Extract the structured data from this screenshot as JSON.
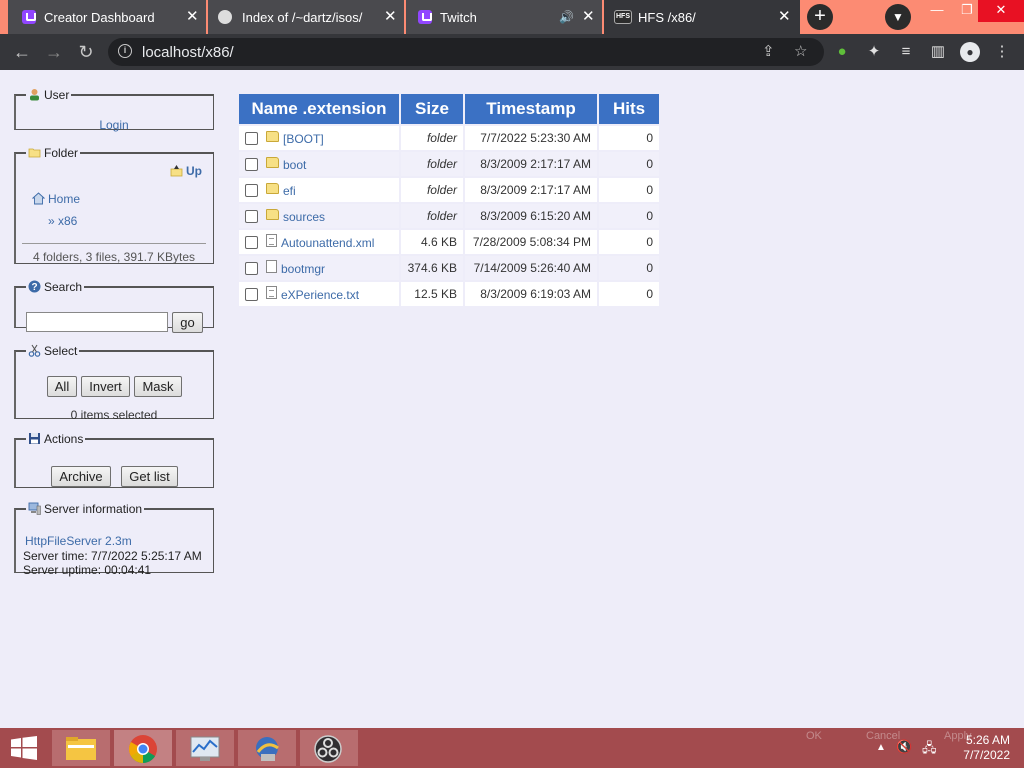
{
  "browser": {
    "tabs": [
      {
        "title": "Creator Dashboard",
        "favicon": "twitch-icon"
      },
      {
        "title": "Index of /~dartz/isos/",
        "favicon": "dartz-icon"
      },
      {
        "title": "Twitch",
        "favicon": "twitch-icon"
      },
      {
        "title": "HFS /x86/",
        "favicon": "hfs-icon",
        "favicon_text": "HFS"
      }
    ],
    "url": "localhost/x86/"
  },
  "sidebar": {
    "user": {
      "legend": "User",
      "login_link": "Login"
    },
    "folder": {
      "legend": "Folder",
      "up_link": "Up",
      "home_link": "Home",
      "current_link": "» x86",
      "summary": "4 folders, 3 files, 391.7 KBytes"
    },
    "search": {
      "legend": "Search",
      "input_value": "",
      "go_button": "go"
    },
    "select": {
      "legend": "Select",
      "buttons": [
        "All",
        "Invert",
        "Mask"
      ],
      "status": "0 items selected"
    },
    "actions": {
      "legend": "Actions",
      "buttons": [
        "Archive",
        "Get list"
      ]
    },
    "server_info": {
      "legend": "Server information",
      "server_link": "HttpFileServer 2.3m",
      "server_time": "Server time: 7/7/2022 5:25:17 AM",
      "server_uptime": "Server uptime: 00:04:41"
    }
  },
  "file_table": {
    "columns": [
      "Name .extension",
      "Size",
      "Timestamp",
      "Hits"
    ],
    "rows": [
      {
        "name": "[BOOT]",
        "type": "folder",
        "size": "folder",
        "timestamp": "7/7/2022 5:23:30 AM",
        "hits": "0"
      },
      {
        "name": "boot",
        "type": "folder",
        "size": "folder",
        "timestamp": "8/3/2009 2:17:17 AM",
        "hits": "0"
      },
      {
        "name": "efi",
        "type": "folder",
        "size": "folder",
        "timestamp": "8/3/2009 2:17:17 AM",
        "hits": "0"
      },
      {
        "name": "sources",
        "type": "folder",
        "size": "folder",
        "timestamp": "8/3/2009 6:15:20 AM",
        "hits": "0"
      },
      {
        "name": "Autounattend.xml",
        "type": "file",
        "size": "4.6 KB",
        "timestamp": "7/28/2009 5:08:34 PM",
        "hits": "0"
      },
      {
        "name": "bootmgr",
        "type": "file",
        "size": "374.6 KB",
        "timestamp": "7/14/2009 5:26:40 AM",
        "hits": "0"
      },
      {
        "name": "eXPerience.txt",
        "type": "file",
        "size": "12.5 KB",
        "timestamp": "8/3/2009 6:19:03 AM",
        "hits": "0"
      }
    ]
  },
  "taskbar": {
    "apps": [
      "file-explorer-icon",
      "chrome-icon",
      "performance-monitor-icon",
      "setup-app-icon",
      "obs-icon"
    ],
    "faded_buttons": [
      "OK",
      "Cancel",
      "Apply"
    ],
    "clock_time": "5:26 AM",
    "clock_date": "7/7/2022"
  },
  "colors": {
    "tabstrip": "#fc8b73",
    "table_header": "#3b71c4",
    "link": "#3d6ba8",
    "page_bg": "#eeedf9",
    "taskbar": "#a34b4e"
  }
}
